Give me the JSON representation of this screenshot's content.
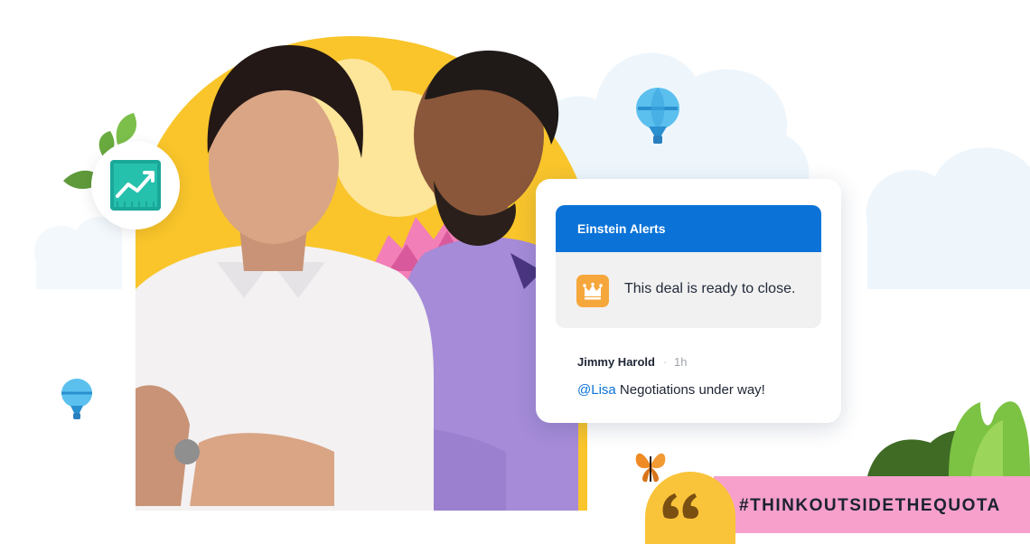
{
  "alert": {
    "header_title": "Einstein Alerts",
    "message": "This deal is ready to close.",
    "icon": "crown-icon"
  },
  "comment": {
    "author": "Jimmy Harold",
    "separator": "·",
    "time": "1h",
    "mention": "@Lisa",
    "text": " Negotiations under way!"
  },
  "banner": {
    "quote_icon": "quote-icon",
    "hashtag": "#THINKOUTSIDETHEQUOTA"
  },
  "graphics": {
    "growth_icon": "trending-up-chart-icon",
    "balloon_icon": "hot-air-balloon-icon",
    "butterfly_icon": "butterfly-icon"
  },
  "colors": {
    "brand_blue": "#0b73d8",
    "crown_orange": "#f6a73c",
    "banner_pink": "#f6a0cb",
    "quote_yellow": "#fac43a",
    "accent_yellow": "#f9c52b",
    "chart_teal": "#1aa89a"
  }
}
